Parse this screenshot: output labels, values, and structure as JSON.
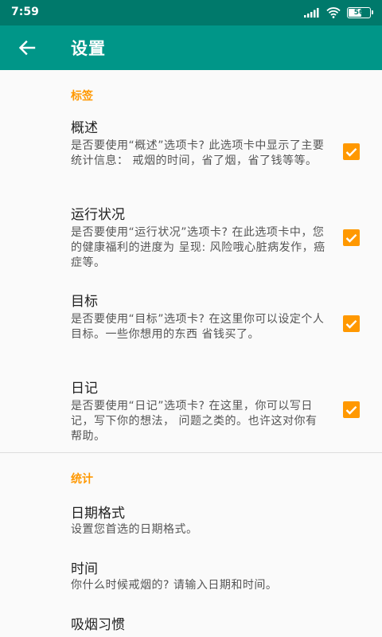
{
  "status_bar": {
    "time": "7:59",
    "battery_level": "56",
    "battery_fraction": 0.56,
    "icons": [
      "signal-icon",
      "wifi-icon",
      "battery-icon"
    ]
  },
  "app_bar": {
    "title": "设置",
    "back_icon": "arrow-left-icon"
  },
  "colors": {
    "primary": "#009688",
    "primary_dark": "#00796b",
    "accent": "#ff9800"
  },
  "sections": [
    {
      "header": "标签",
      "items": [
        {
          "title": "概述",
          "summary": "是否要使用“概述”选项卡? 此选项卡中显示了主要统计信息： 戒烟的时间，省了烟，省了钱等等。",
          "checked": true
        },
        {
          "title": "运行状况",
          "summary": "是否要使用“运行状况”选项卡? 在此选项卡中，您的健康福利的进度为 呈现: 风险哦心脏病发作，癌症等。",
          "checked": true
        },
        {
          "title": "目标",
          "summary": "是否要使用“目标”选项卡? 在这里你可以设定个人目标。一些你想用的东西 省钱买了。",
          "checked": true
        },
        {
          "title": "日记",
          "summary": "是否要使用“日记”选项卡? 在这里，你可以写日记，写下你的想法， 问题之类的。也许这对你有帮助。",
          "checked": true
        }
      ]
    },
    {
      "header": "统计",
      "items": [
        {
          "title": "日期格式",
          "summary": "设置您首选的日期格式。"
        },
        {
          "title": "时间",
          "summary": "你什么时候戒烟的? 请输入日期和时间。"
        },
        {
          "title": "吸烟习惯",
          "summary": ""
        }
      ]
    }
  ]
}
